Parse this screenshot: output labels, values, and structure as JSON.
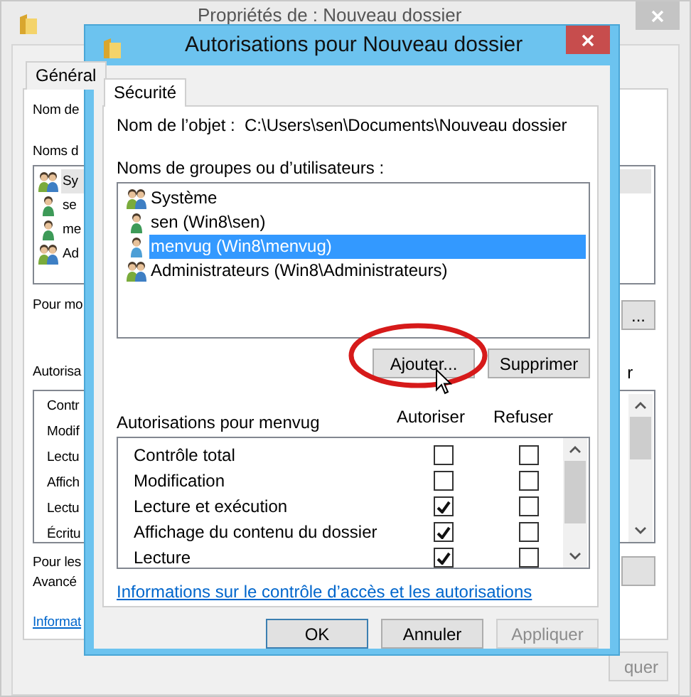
{
  "back_window": {
    "title": "Propriétés de : Nouveau dossier",
    "tabs": [
      {
        "label": "Général",
        "selected": false
      }
    ],
    "object_label": "Nom de",
    "groups_label": "Noms d",
    "users": [
      {
        "name": "Sy",
        "kind": "group",
        "selected": true
      },
      {
        "name": "se",
        "kind": "user",
        "selected": false
      },
      {
        "name": "me",
        "kind": "user",
        "selected": false
      },
      {
        "name": "Ad",
        "kind": "group",
        "selected": false
      }
    ],
    "change_label": "Pour mo",
    "edit_button": "...",
    "perms_label": "Autorisa",
    "column_fragment": "r",
    "permissions": [
      "Contr",
      "Modif",
      "Lectu",
      "Affich",
      "Lectu",
      "Écritu"
    ],
    "advanced_lines": [
      "Pour les",
      "Avancé"
    ],
    "link": "Informat",
    "apply_button": "quer"
  },
  "dialog": {
    "title": "Autorisations pour Nouveau dossier",
    "tabs": [
      {
        "label": "Sécurité",
        "selected": true
      }
    ],
    "object_label": "Nom de l’objet :",
    "object_path": "C:\\Users\\sen\\Documents\\Nouveau dossier",
    "groups_label": "Noms de groupes ou d’utilisateurs :",
    "users": [
      {
        "name": "Système",
        "kind": "group",
        "selected": false
      },
      {
        "name": "sen (Win8\\sen)",
        "kind": "user",
        "selected": false
      },
      {
        "name": "menvug (Win8\\menvug)",
        "kind": "user",
        "selected": true
      },
      {
        "name": "Administrateurs (Win8\\Administrateurs)",
        "kind": "group",
        "selected": false
      }
    ],
    "add_button": {
      "label": "Ajouter...",
      "circled": true
    },
    "remove_button": "Supprimer",
    "perms_label": "Autorisations pour menvug",
    "columns": [
      "Autoriser",
      "Refuser"
    ],
    "permissions": [
      {
        "name": "Contrôle total",
        "allow": false,
        "deny": false
      },
      {
        "name": "Modification",
        "allow": false,
        "deny": false
      },
      {
        "name": "Lecture et exécution",
        "allow": true,
        "deny": false
      },
      {
        "name": "Affichage du contenu du dossier",
        "allow": true,
        "deny": false
      },
      {
        "name": "Lecture",
        "allow": true,
        "deny": false
      }
    ],
    "link": "Informations sur le contrôle d’accès et les autorisations",
    "buttons": [
      {
        "label": "OK",
        "kind": "default",
        "disabled": false
      },
      {
        "label": "Annuler",
        "kind": "normal",
        "disabled": false
      },
      {
        "label": "Appliquer",
        "kind": "normal",
        "disabled": true
      }
    ]
  }
}
